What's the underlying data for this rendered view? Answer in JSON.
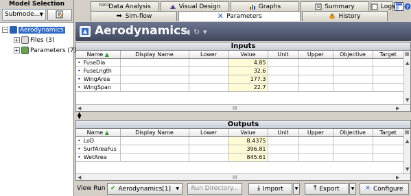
{
  "model_selection": {
    "title": "Model Selection",
    "submode": "Submode...",
    "tree": [
      {
        "label": "Aerodynamics",
        "selected": true
      },
      {
        "label": "Files (3)"
      },
      {
        "label": "Parameters (7)"
      }
    ]
  },
  "tabs_top": [
    "Data Analysis",
    "Visual Design",
    "Graphs",
    "Summary",
    "Logs"
  ],
  "tabs_bottom": [
    "Sim-flow",
    "Parameters",
    "History"
  ],
  "active_tab": "Parameters",
  "banner": {
    "title": "Aerodynamics"
  },
  "columns": [
    "Name",
    "Display Name",
    "Lower",
    "Value",
    "Unit",
    "Upper",
    "Objective",
    "Target"
  ],
  "inputs": {
    "title": "Inputs",
    "rows": [
      {
        "name": "FuseDia",
        "value": "4.85"
      },
      {
        "name": "FuseLngth",
        "value": "32.6"
      },
      {
        "name": "WingArea",
        "value": "177.3"
      },
      {
        "name": "WingSpan",
        "value": "22.7"
      }
    ]
  },
  "outputs": {
    "title": "Outputs",
    "rows": [
      {
        "name": "LoD",
        "value": "8.4375"
      },
      {
        "name": "SurfAreaFus",
        "value": "396.81"
      },
      {
        "name": "WetArea",
        "value": "845.61"
      }
    ]
  },
  "scroll_grip": "III",
  "bottom": {
    "view_run_label": "View Run",
    "run_value": "Aerodynamics[1]",
    "run_directory": "Run Directory...",
    "import": "Import",
    "export": "Export",
    "configure": "Configure"
  },
  "colors": {
    "banner": "#4a5268",
    "selection": "#316ac5",
    "value_bg": "#fffbd6"
  }
}
